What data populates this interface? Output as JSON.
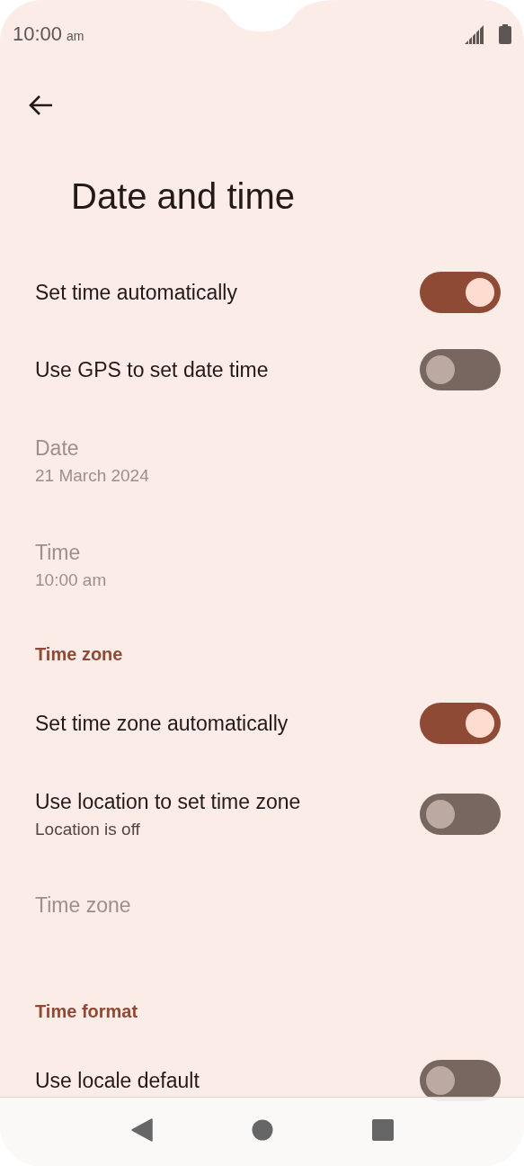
{
  "status_bar": {
    "time": "10:00",
    "period": "am"
  },
  "title": "Date and time",
  "items": [
    {
      "kind": "toggle",
      "title": "Set time automatically",
      "on": true
    },
    {
      "kind": "toggle",
      "title": "Use GPS to set date time",
      "on": false
    },
    {
      "kind": "info",
      "title": "Date",
      "summary": "21 March 2024",
      "disabled": true
    },
    {
      "kind": "info",
      "title": "Time",
      "summary": "10:00 am",
      "disabled": true
    },
    {
      "kind": "header",
      "title": "Time zone"
    },
    {
      "kind": "toggle",
      "title": "Set time zone automatically",
      "on": true
    },
    {
      "kind": "toggle",
      "title": "Use location to set time zone",
      "summary": "Location is off",
      "on": false
    },
    {
      "kind": "info",
      "title": "Time zone",
      "disabled": true
    },
    {
      "kind": "header",
      "title": "Time format"
    },
    {
      "kind": "toggle",
      "title": "Use locale default",
      "on": false
    }
  ]
}
